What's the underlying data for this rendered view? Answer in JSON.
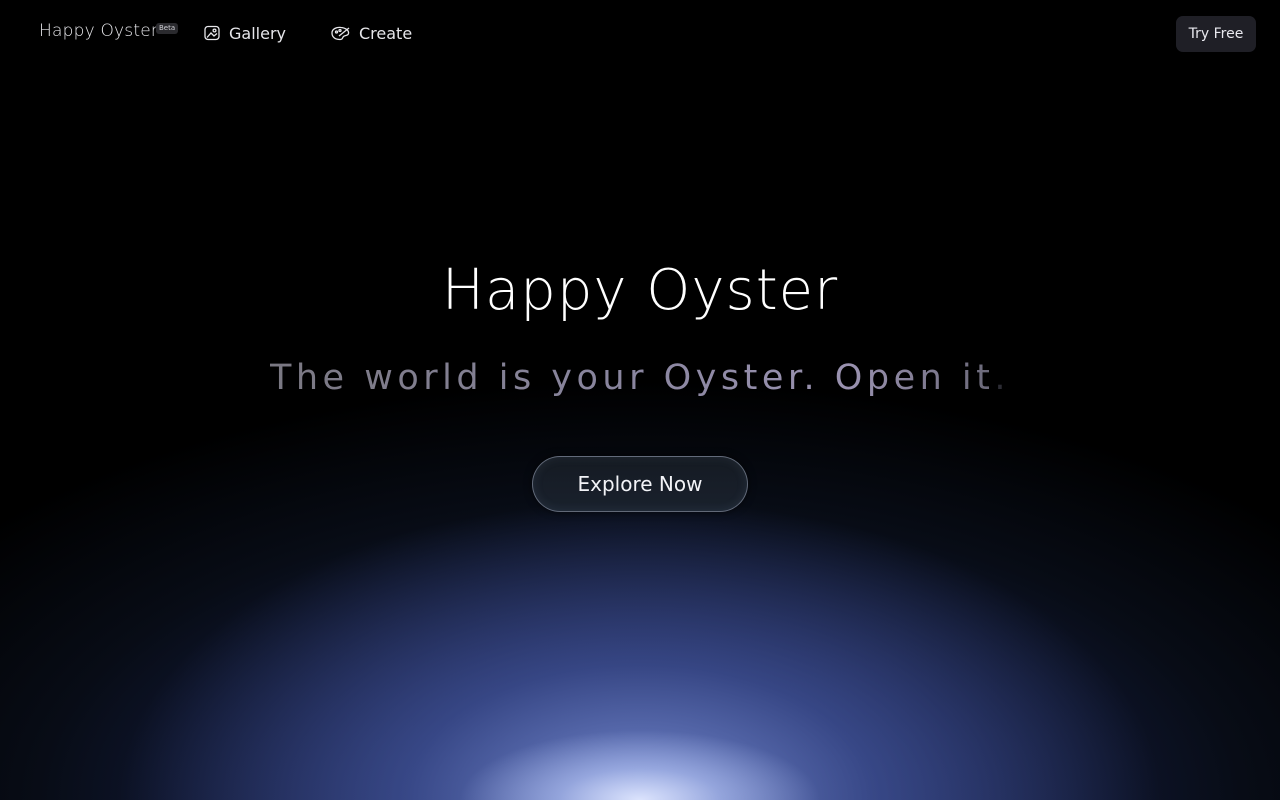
{
  "header": {
    "brand": "Happy Oyster",
    "badge": "Beta",
    "nav": [
      {
        "label": "Gallery",
        "icon": "gallery-icon"
      },
      {
        "label": "Create",
        "icon": "palette-icon"
      }
    ],
    "cta_label": "Try Free"
  },
  "hero": {
    "title": "Happy Oyster",
    "subtitle": "The world is your Oyster. Open it",
    "subtitle_end": ".",
    "button_label": "Explore Now"
  },
  "colors": {
    "background": "#000000",
    "glow": "#8fa4e6",
    "button_bg": "#1f1f26"
  }
}
